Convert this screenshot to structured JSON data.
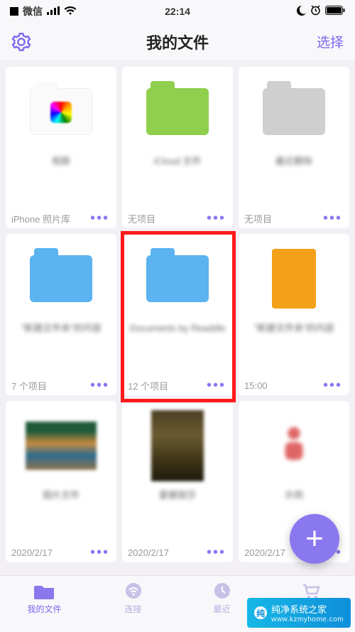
{
  "status": {
    "app": "微信",
    "time": "22:14"
  },
  "nav": {
    "title": "我的文件",
    "select": "选择"
  },
  "items": [
    {
      "name": "相册",
      "meta": "iPhone 照片库",
      "icon": "white-photos-folder"
    },
    {
      "name": "iCloud 文件",
      "meta": "无项目",
      "icon": "green-folder"
    },
    {
      "name": "最近删除",
      "meta": "无项目",
      "icon": "grey-folder"
    },
    {
      "name": "\"新建文件夹\"的内容",
      "meta": "7 个项目",
      "icon": "blue-folder"
    },
    {
      "name": "Documents\nby Readdle",
      "meta": "12 个项目",
      "icon": "blue-folder"
    },
    {
      "name": "\"新建文件夹\"的内容",
      "meta": "15:00",
      "icon": "orange-file"
    },
    {
      "name": "图片文件",
      "meta": "2020/2/17",
      "icon": "landscape-image"
    },
    {
      "name": "蒙娜丽莎",
      "meta": "2020/2/17",
      "icon": "mona-image"
    },
    {
      "name": "示例",
      "meta": "2020/2/17",
      "icon": "people-icon"
    }
  ],
  "tabs": {
    "files": "我的文件",
    "connect": "连接",
    "recent": "最近",
    "store": "商店"
  },
  "fab": "+",
  "watermark": {
    "brand": "纯净系统之家",
    "url": "www.kzmyhome.com"
  }
}
